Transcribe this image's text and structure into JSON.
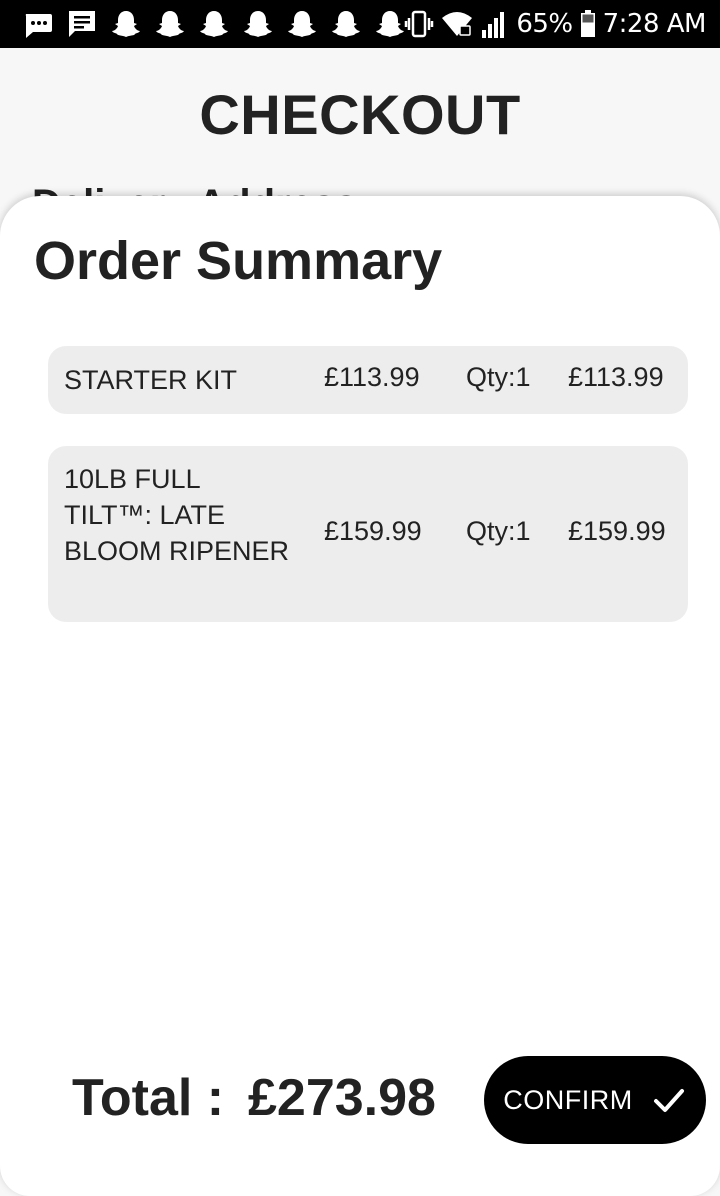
{
  "status_bar": {
    "battery_percent": "65%",
    "time": "7:28 AM",
    "icons": [
      "message-bubble-icon",
      "chat-icon",
      "snapchat-icon",
      "snapchat-icon",
      "snapchat-icon",
      "snapchat-icon",
      "snapchat-icon",
      "snapchat-icon",
      "snapchat-icon",
      "vibrate-icon",
      "wifi-icon",
      "signal-icon",
      "battery-icon"
    ]
  },
  "page": {
    "title": "CHECKOUT",
    "section_peek": "Delivery Address"
  },
  "sheet": {
    "title": "Order Summary",
    "items": [
      {
        "name": "STARTER KIT",
        "price": "£113.99",
        "qty": "Qty:1",
        "subtotal": "£113.99"
      },
      {
        "name": "10LB FULL TILT™: LATE BLOOM RIPENER",
        "price": "£159.99",
        "qty": "Qty:1",
        "subtotal": "£159.99"
      }
    ],
    "total_label": "Total :",
    "total_value": "£273.98",
    "confirm_label": "CONFIRM"
  }
}
